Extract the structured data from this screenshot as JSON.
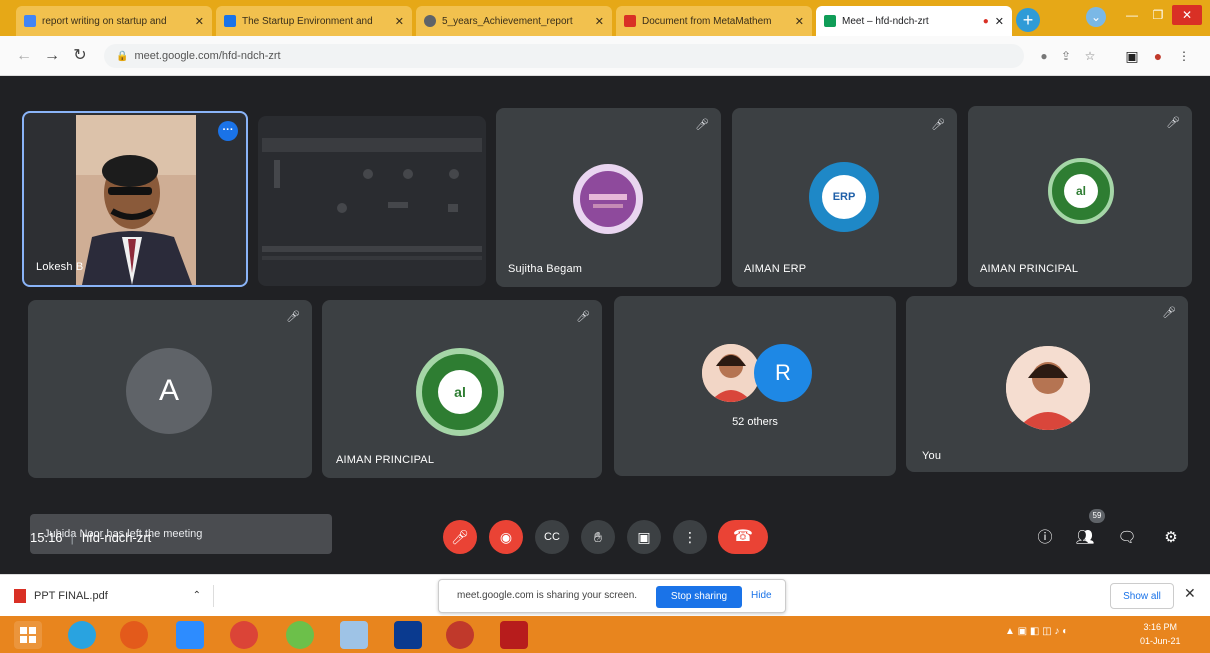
{
  "browser": {
    "tabs": [
      {
        "title": "report writing on startup and",
        "fav_color": "#4285f4"
      },
      {
        "title": "The Startup Environment and",
        "fav_color": "#1a73e8"
      },
      {
        "title": "5_years_Achievement_report",
        "fav_color": "#5f6368"
      },
      {
        "title": "Document from MetaMathem",
        "fav_color": "#d93025"
      },
      {
        "title": "Meet – hfd-ndch-zrt",
        "fav_color": "#0f9d58"
      }
    ],
    "url": "meet.google.com/hfd-ndch-zrt"
  },
  "meeting": {
    "time": "15.16",
    "code": "hfd-ndch-zrt",
    "participant_count": "59",
    "participants": [
      {
        "name": "Lokesh B"
      },
      {
        "name": "Sujitha Begam"
      },
      {
        "name": "AIMAN ERP"
      },
      {
        "name": "AIMAN PRINCIPAL"
      },
      {
        "name": "AIMAN PRINCIPAL"
      },
      {
        "name": "52 others"
      },
      {
        "name": "You"
      }
    ],
    "avatar_letter": "A",
    "others_letter": "R",
    "erp_logo_text": "ERP",
    "principal_logo_text": "al",
    "left_notice": "Juhida Noor has left the meeting"
  },
  "downloads": {
    "file": "PPT FINAL.pdf",
    "sharing_text": "meet.google.com is sharing your screen.",
    "stop_label": "Stop sharing",
    "hide_label": "Hide",
    "show_all_label": "Show all"
  },
  "taskbar": {
    "time": "3:16 PM",
    "date": "01-Jun-21"
  },
  "colors": {
    "meet_bg": "#202124",
    "tile_bg": "#3c4043",
    "accent": "#1a73e8",
    "danger": "#ea4335"
  }
}
